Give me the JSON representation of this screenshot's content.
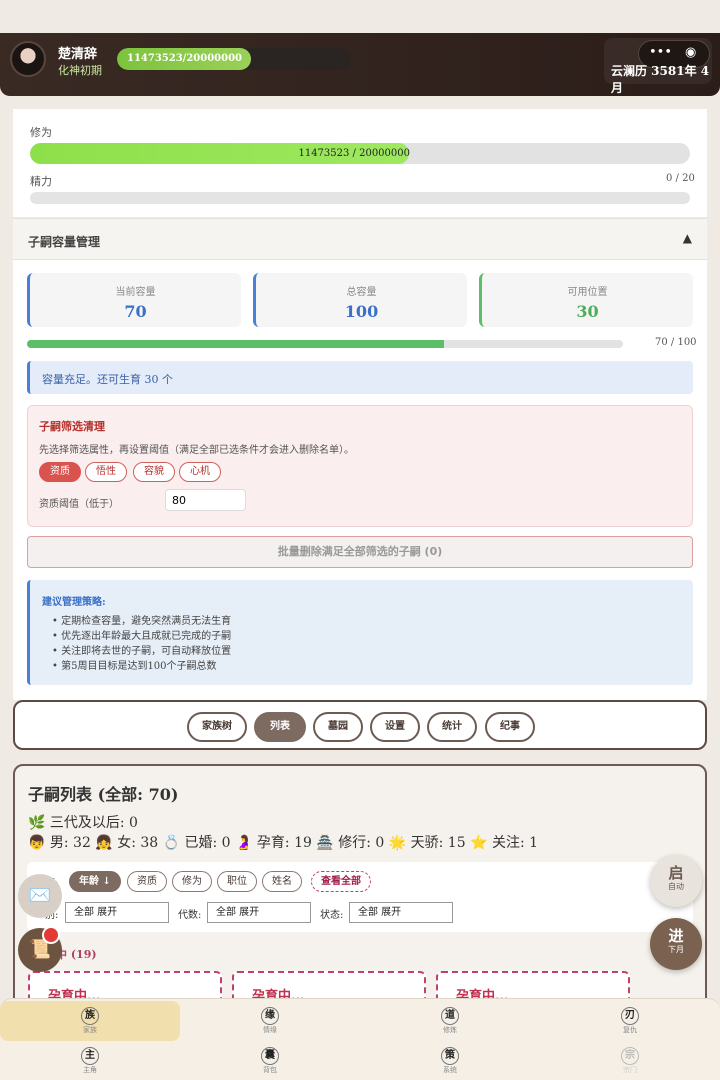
{
  "header": {
    "name": "楚清辞",
    "realm": "化神初期",
    "cultivation_text": "11473523/20000000",
    "cultivation_fraction": 0.5737,
    "calendar": "云澜历 3581年 4月",
    "capsule_more": "•••",
    "capsule_close": "◉"
  },
  "status": {
    "cultivation_label": "修为",
    "cultivation_value": "11473523 / 20000000",
    "energy_label": "精力",
    "energy_value": "0 / 20"
  },
  "capacity": {
    "section_title": "子嗣容量管理",
    "collapse_icon": "▲",
    "current_label": "当前容量",
    "current_value": "70",
    "total_label": "总容量",
    "total_value": "100",
    "available_label": "可用位置",
    "available_value": "30",
    "usage_text": "70 / 100",
    "usage_fraction": 0.7,
    "notice": "容量充足。还可生育 30 个",
    "colors": {
      "blue": "#3a70c8",
      "green": "#4cae5a"
    }
  },
  "filter": {
    "title": "子嗣筛选清理",
    "desc": "先选择筛选属性，再设置阈值（满足全部已选条件才会进入删除名单）。",
    "chips": [
      "资质",
      "悟性",
      "容貌",
      "心机"
    ],
    "threshold_label": "资质阈值（低于）",
    "threshold_value": "80",
    "batch_delete": "批量删除满足全部筛选的子嗣 (0)"
  },
  "advice": {
    "title": "建议管理策略:",
    "items": [
      "定期检查容量，避免突然满员无法生育",
      "优先逐出年龄最大且成就已完成的子嗣",
      "关注即将去世的子嗣，可自动释放位置",
      "第5周目目标是达到100个子嗣总数"
    ]
  },
  "tabs": [
    "家族树",
    "列表",
    "墓园",
    "设置",
    "统计",
    "纪事"
  ],
  "list": {
    "title": "子嗣列表 (全部: 70)",
    "generation": "🌿 三代及以后: 0",
    "counts": "👦 男: 32  👧 女: 38  💍 已婚: 0  🤰 孕育: 19  🏯 修行: 0  🌟 天骄: 15  ⭐ 关注: 1",
    "sort_label": "序:",
    "sort_options": [
      "年龄 ↓",
      "资质",
      "修为",
      "职位",
      "姓名"
    ],
    "view_all": "查看全部",
    "filter1_label": "别:",
    "filter1_value": "全部 展开",
    "filter2_label": "代数:",
    "filter2_value": "全部 展开",
    "filter3_label": "状态:",
    "filter3_value": "全部 展开",
    "group_title": "中 (19)",
    "cards": [
      "孕育中...",
      "孕育中...",
      "孕育中..."
    ]
  },
  "fabs": {
    "auto_main": "启",
    "auto_sub": "自动",
    "next_main": "进",
    "next_sub": "下月",
    "mail_icon": "✉️",
    "scroll_icon": "📜"
  },
  "nav": [
    {
      "icon": "族",
      "label": "家族"
    },
    {
      "icon": "缘",
      "label": "情缘"
    },
    {
      "icon": "道",
      "label": "修炼"
    },
    {
      "icon": "刃",
      "label": "复仇"
    },
    {
      "icon": "主",
      "label": "主角"
    },
    {
      "icon": "囊",
      "label": "背包"
    },
    {
      "icon": "策",
      "label": "系统"
    },
    {
      "icon": "宗",
      "label": "宗门"
    }
  ]
}
